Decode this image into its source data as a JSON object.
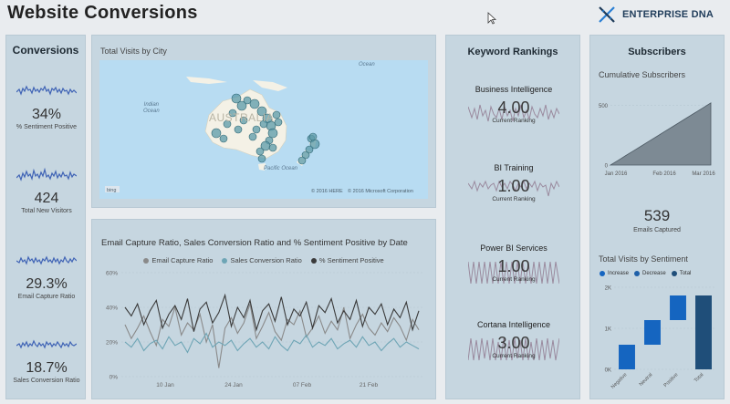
{
  "header": {
    "title": "Website Conversions",
    "logo_text": "ENTERPRISE DNA"
  },
  "conversions": {
    "title": "Conversions",
    "kpis": [
      {
        "value": "34%",
        "label": "% Sentiment Positive"
      },
      {
        "value": "424",
        "label": "Total New Visitors"
      },
      {
        "value": "29.3%",
        "label": "Email Capture Ratio"
      },
      {
        "value": "18.7%",
        "label": "Sales Conversion Ratio"
      }
    ],
    "sparkline_color": "#3f63b5"
  },
  "map": {
    "title": "Total Visits by City",
    "labels": {
      "ocean_top": "Ocean",
      "indian": "Indian",
      "indian2": "Ocean",
      "pacific": "Pacific Ocean",
      "country": "AUSTRALIA"
    },
    "credits": {
      "bing": "bing",
      "here": "© 2016 HERE",
      "ms": "© 2016 Microsoft Corporation"
    }
  },
  "line_chart": {
    "title": "Email Capture Ratio, Sales Conversion Ratio and % Sentiment Positive by Date",
    "legend": [
      {
        "name": "Email Capture Ratio",
        "color": "#8a8a8a"
      },
      {
        "name": "Sales Conversion Ratio",
        "color": "#6ea5b5"
      },
      {
        "name": "% Sentiment Positive",
        "color": "#3a3a3a"
      }
    ]
  },
  "keywords": {
    "title": "Keyword Rankings",
    "items": [
      {
        "name": "Business Intelligence",
        "value": "4.00",
        "sub": "Current Ranking"
      },
      {
        "name": "BI Training",
        "value": "1.00",
        "sub": "Current Ranking"
      },
      {
        "name": "Power BI Services",
        "value": "1.00",
        "sub": "Current Ranking"
      },
      {
        "name": "Cortana Intelligence",
        "value": "3.00",
        "sub": "Current Ranking"
      }
    ]
  },
  "subscribers": {
    "title": "Subscribers",
    "cumulative_title": "Cumulative Subscribers",
    "emails_value": "539",
    "emails_label": "Emails Captured",
    "sentiment_title": "Total Visits by Sentiment",
    "sentiment_legend": [
      {
        "name": "Increase",
        "color": "#1565c0"
      },
      {
        "name": "Decrease",
        "color": "#1e5fa8"
      },
      {
        "name": "Total",
        "color": "#1f4e79"
      }
    ]
  },
  "chart_data": [
    {
      "type": "line",
      "title": "Email Capture Ratio, Sales Conversion Ratio and % Sentiment Positive by Date",
      "xlabel": "",
      "ylabel": "",
      "x_ticks": [
        "10 Jan",
        "24 Jan",
        "07 Feb",
        "21 Feb"
      ],
      "y_ticks": [
        "0%",
        "20%",
        "40%",
        "60%"
      ],
      "ylim": [
        0,
        0.6
      ],
      "grid": true,
      "legend_position": "top",
      "series": [
        {
          "name": "Email Capture Ratio",
          "color": "#8a8a8a",
          "values": [
            0.3,
            0.22,
            0.28,
            0.35,
            0.26,
            0.18,
            0.33,
            0.29,
            0.4,
            0.24,
            0.31,
            0.27,
            0.36,
            0.2,
            0.3,
            0.05,
            0.28,
            0.34,
            0.25,
            0.31,
            0.42,
            0.22,
            0.29,
            0.37,
            0.26,
            0.21,
            0.33,
            0.3,
            0.38,
            0.23,
            0.28,
            0.35,
            0.25,
            0.32,
            0.27,
            0.4,
            0.22,
            0.3,
            0.36,
            0.28,
            0.24,
            0.31,
            0.26,
            0.34,
            0.29,
            0.21,
            0.33,
            0.27
          ]
        },
        {
          "name": "Sales Conversion Ratio",
          "color": "#6ea5b5",
          "values": [
            0.2,
            0.17,
            0.22,
            0.15,
            0.19,
            0.21,
            0.16,
            0.23,
            0.18,
            0.2,
            0.14,
            0.22,
            0.19,
            0.25,
            0.17,
            0.2,
            0.18,
            0.21,
            0.15,
            0.19,
            0.22,
            0.17,
            0.2,
            0.16,
            0.23,
            0.18,
            0.15,
            0.21,
            0.19,
            0.24,
            0.17,
            0.2,
            0.18,
            0.22,
            0.16,
            0.19,
            0.21,
            0.17,
            0.23,
            0.18,
            0.2,
            0.15,
            0.19,
            0.22,
            0.17,
            0.2,
            0.18,
            0.16
          ]
        },
        {
          "name": "% Sentiment Positive",
          "color": "#3a3a3a",
          "values": [
            0.4,
            0.35,
            0.42,
            0.3,
            0.38,
            0.44,
            0.28,
            0.36,
            0.41,
            0.33,
            0.45,
            0.26,
            0.39,
            0.43,
            0.31,
            0.37,
            0.47,
            0.29,
            0.4,
            0.34,
            0.44,
            0.27,
            0.38,
            0.42,
            0.32,
            0.46,
            0.3,
            0.39,
            0.35,
            0.43,
            0.28,
            0.41,
            0.37,
            0.45,
            0.31,
            0.38,
            0.33,
            0.44,
            0.29,
            0.4,
            0.36,
            0.42,
            0.3,
            0.39,
            0.34,
            0.43,
            0.27,
            0.38
          ]
        }
      ]
    },
    {
      "type": "area",
      "title": "Cumulative Subscribers",
      "x_ticks": [
        "Jan 2016",
        "Feb 2016",
        "Mar 2016"
      ],
      "y_ticks": [
        "0",
        "500"
      ],
      "ylim": [
        0,
        550
      ],
      "series": [
        {
          "values": [
            0,
            40,
            80,
            120,
            160,
            200,
            240,
            280,
            320,
            360,
            400,
            440,
            480,
            520
          ]
        }
      ]
    },
    {
      "type": "bar",
      "title": "Total Visits by Sentiment",
      "categories": [
        "Negative",
        "Neutral",
        "Positive",
        "Total"
      ],
      "y_ticks": [
        "0K",
        "1K",
        "2K"
      ],
      "ylim": [
        0,
        2000
      ],
      "waterfall": [
        {
          "category": "Negative",
          "start": 0,
          "end": 600,
          "kind": "Increase"
        },
        {
          "category": "Neutral",
          "start": 600,
          "end": 1200,
          "kind": "Increase"
        },
        {
          "category": "Positive",
          "start": 1200,
          "end": 1800,
          "kind": "Increase"
        },
        {
          "category": "Total",
          "start": 0,
          "end": 1800,
          "kind": "Total"
        }
      ]
    }
  ]
}
